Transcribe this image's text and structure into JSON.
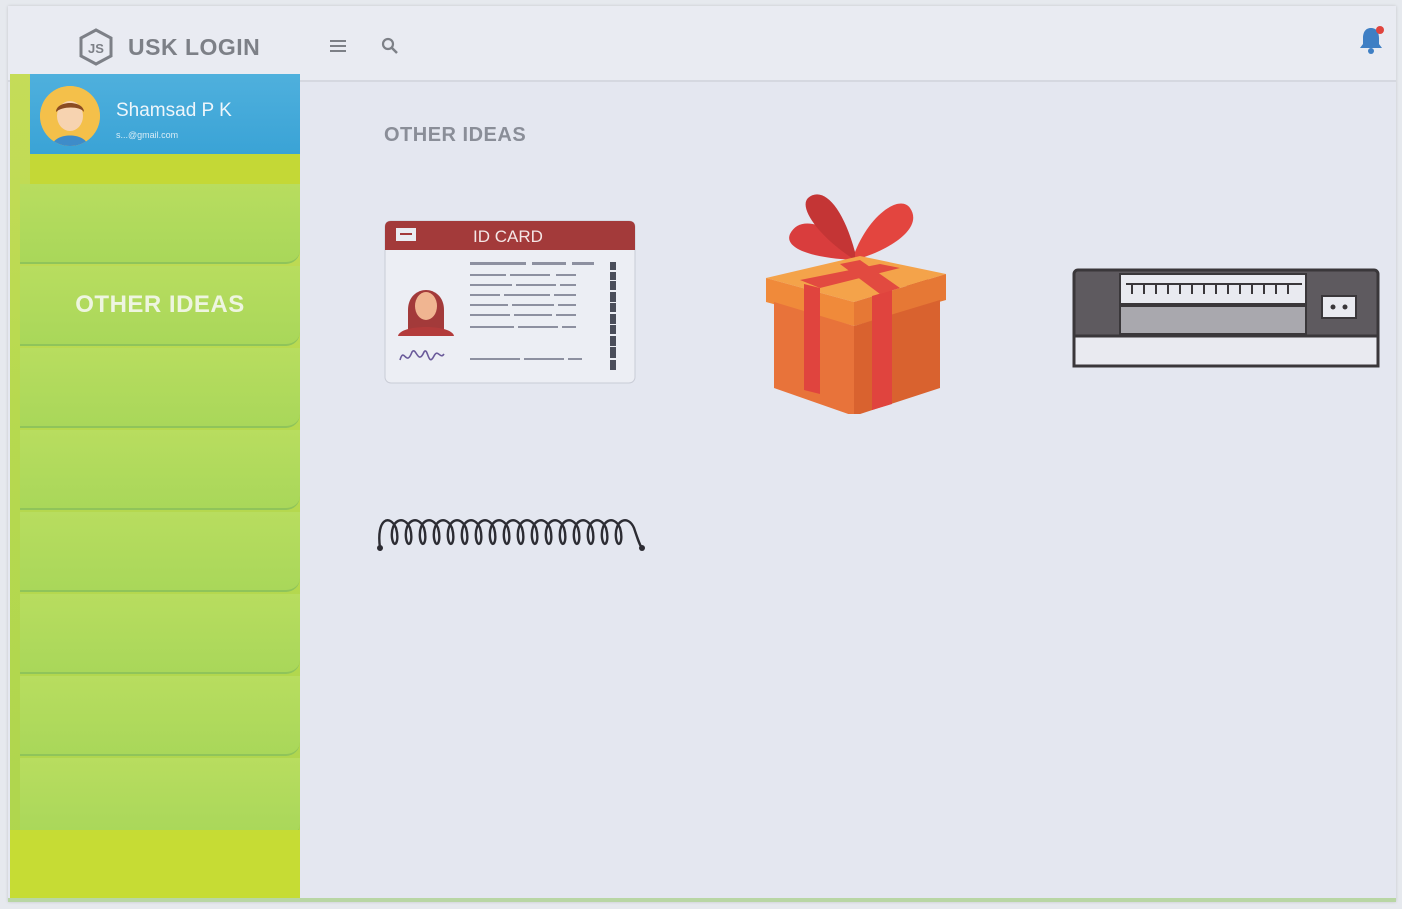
{
  "header": {
    "app_title": "USK LOGIN",
    "logo_icon": "js-hexagon-icon",
    "menu_icon": "hamburger-menu-icon",
    "search_icon": "search-icon",
    "notification_icon": "bell-icon"
  },
  "sidebar": {
    "profile": {
      "name": "Shamsad P K",
      "email": "s...@gmail.com"
    },
    "items": [
      {
        "label": ""
      },
      {
        "label": "OTHER IDEAS"
      },
      {
        "label": ""
      },
      {
        "label": ""
      },
      {
        "label": ""
      },
      {
        "label": ""
      },
      {
        "label": ""
      },
      {
        "label": ""
      },
      {
        "label": ""
      }
    ]
  },
  "main": {
    "section_title": "OTHER IDEAS",
    "tiles": [
      {
        "name": "id-card",
        "label": "ID CARD",
        "icon": "id-card-icon"
      },
      {
        "name": "gift",
        "icon": "gift-box-icon"
      },
      {
        "name": "laminator",
        "icon": "laminator-icon"
      },
      {
        "name": "spiral-binding",
        "icon": "spiral-binding-icon"
      }
    ]
  },
  "colors": {
    "sidebar_green": "#b3d95a",
    "profile_blue": "#3aa3d6",
    "id_header": "#a33a3a",
    "gift_red": "#e5463f",
    "gift_orange": "#f08a3a"
  }
}
